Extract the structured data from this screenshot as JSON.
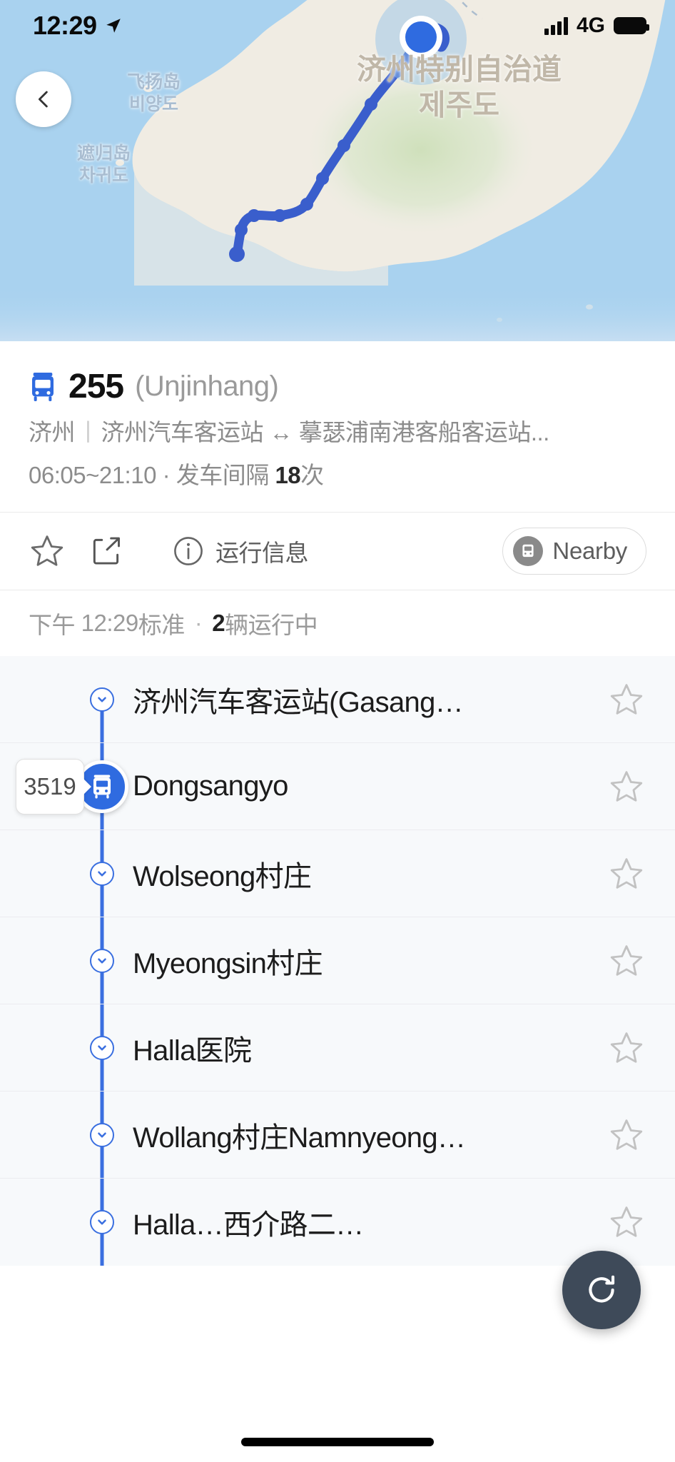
{
  "status_bar": {
    "time": "12:29",
    "location_icon": "location-arrow-icon",
    "network": "4G",
    "signal_icon": "signal-bars-icon",
    "battery_icon": "battery-full-icon"
  },
  "map": {
    "back_icon": "chevron-left-icon",
    "labels": [
      {
        "name": "jeju-province",
        "cn": "济州特别自治道",
        "kr": "제주도"
      },
      {
        "name": "biyangdo-island",
        "cn": "飞扬岛",
        "kr": "비양도"
      },
      {
        "name": "chagwido-island",
        "cn": "遮归岛",
        "kr": "차귀도"
      }
    ],
    "colors": {
      "sea": "#a9d2ef",
      "land": "#f0ece3",
      "forest": "#d6e4c4",
      "route": "#3a5ecc",
      "marker": "#2f6be0"
    }
  },
  "route": {
    "bus_icon": "bus-icon",
    "number": "255",
    "alias": "(Unjinhang)",
    "region": "济州",
    "separator": "丨",
    "endpoints": "济州汽车客运站 ↔ 摹瑟浦南港客船客运站...",
    "operating_hours": "06:05~21:10",
    "mid_dot": "·",
    "interval_label": "发车间隔",
    "interval_value": "18",
    "interval_unit": "次"
  },
  "actions": {
    "favorite_icon": "star-outline-icon",
    "share_icon": "share-icon",
    "info_icon": "info-circle-icon",
    "info_label": "运行信息",
    "nearby_icon": "bus-stop-icon",
    "nearby_label": "Nearby"
  },
  "live_status": {
    "time_prefix": "下午",
    "time": "12:29",
    "standard_label": "标准",
    "mid_dot": "·",
    "running_count": "2",
    "running_label": "辆运行中"
  },
  "stops": [
    {
      "name": "济州汽车客运站(Gasang…",
      "marker": "chevron-down-node",
      "star_icon": "star-outline-icon",
      "vehicle_badge": null
    },
    {
      "name": "Dongsangyo",
      "marker": "bus-node",
      "star_icon": "star-outline-icon",
      "vehicle_badge": "3519"
    },
    {
      "name": "Wolseong村庄",
      "marker": "chevron-down-node",
      "star_icon": "star-outline-icon",
      "vehicle_badge": null
    },
    {
      "name": "Myeongsin村庄",
      "marker": "chevron-down-node",
      "star_icon": "star-outline-icon",
      "vehicle_badge": null
    },
    {
      "name": "Halla医院",
      "marker": "chevron-down-node",
      "star_icon": "star-outline-icon",
      "vehicle_badge": null
    },
    {
      "name": "Wollang村庄Namnyeong…",
      "marker": "chevron-down-node",
      "star_icon": "star-outline-icon",
      "vehicle_badge": null
    },
    {
      "name": "Halla…西介路二…",
      "marker": "chevron-down-node",
      "star_icon": "star-outline-icon",
      "vehicle_badge": null
    }
  ],
  "fab": {
    "icon": "refresh-icon"
  },
  "theme": {
    "accent": "#3a6fe0",
    "fab_bg": "#3e4a59",
    "list_bg": "#f7f9fb",
    "text_primary": "#1c1c1c",
    "text_secondary": "#8c8c8c"
  }
}
